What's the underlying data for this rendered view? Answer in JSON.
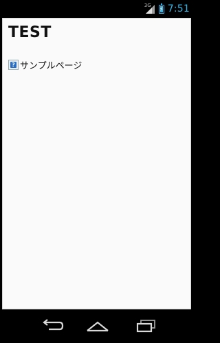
{
  "status_bar": {
    "network_type": "3G",
    "time": "7:51",
    "accent_color": "#33b5e5",
    "icons": [
      "signal-icon",
      "battery-icon"
    ]
  },
  "page": {
    "title": "TEST",
    "link": {
      "text": "サンプルページ",
      "image_icon": "broken-image-icon"
    }
  },
  "navigation_bar": {
    "buttons": [
      "back-icon",
      "home-icon",
      "recent-apps-icon"
    ]
  }
}
